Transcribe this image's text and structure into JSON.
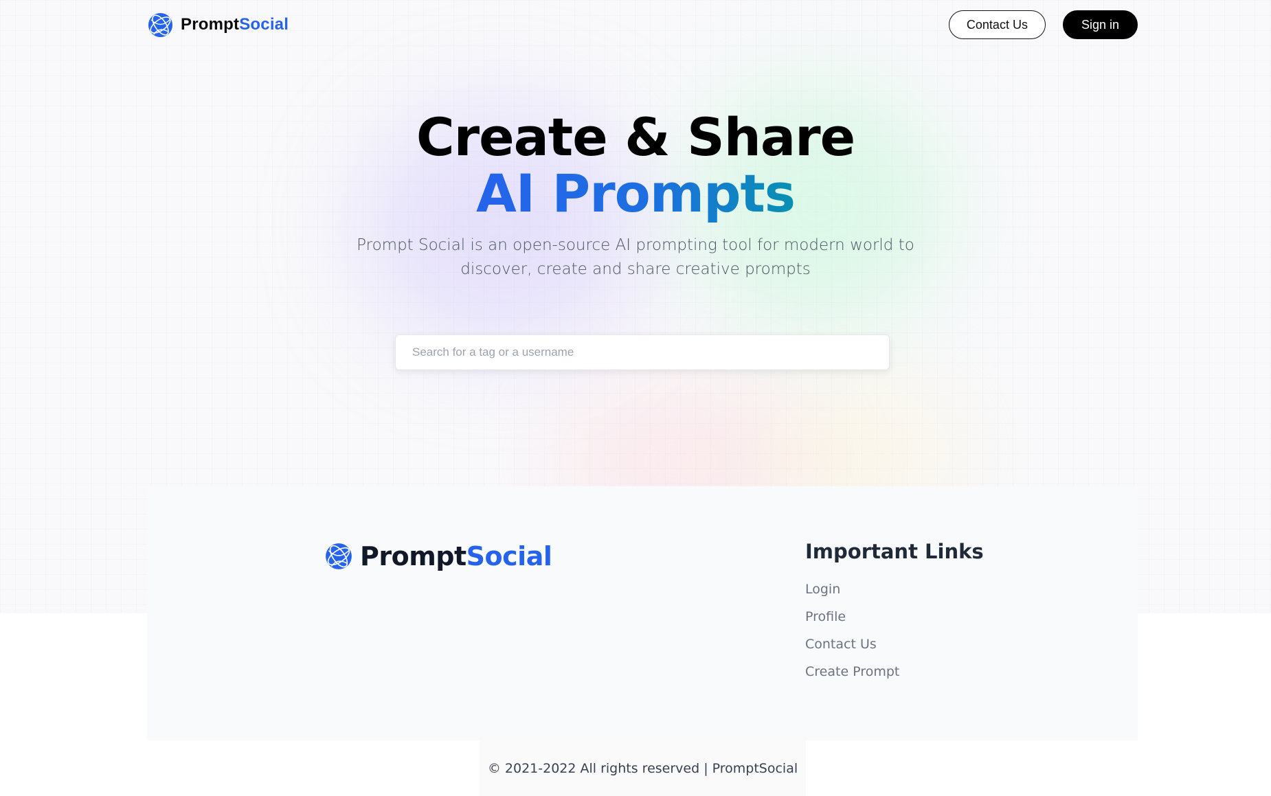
{
  "nav": {
    "brand_prefix": "Prompt",
    "brand_suffix": "Social",
    "contact_label": "Contact Us",
    "signin_label": "Sign in"
  },
  "hero": {
    "title_line1": "Create & Share",
    "title_line2": "AI Prompts",
    "subtitle": "Prompt Social is an open-source AI prompting tool for modern world to discover, create and share creative prompts"
  },
  "search": {
    "placeholder": "Search for a tag or a username",
    "value": ""
  },
  "footer": {
    "brand_prefix": "Prompt",
    "brand_suffix": "Social",
    "links_heading": "Important Links",
    "links": [
      {
        "label": "Login"
      },
      {
        "label": "Profile"
      },
      {
        "label": "Contact Us"
      },
      {
        "label": "Create Prompt"
      }
    ],
    "copyright": "© 2021-2022 All rights reserved | PromptSocial"
  },
  "icons": {
    "brand": "globe-icon"
  },
  "colors": {
    "accent": "#2563eb",
    "accent_teal": "#0891b2",
    "dark_button": "#000000"
  }
}
